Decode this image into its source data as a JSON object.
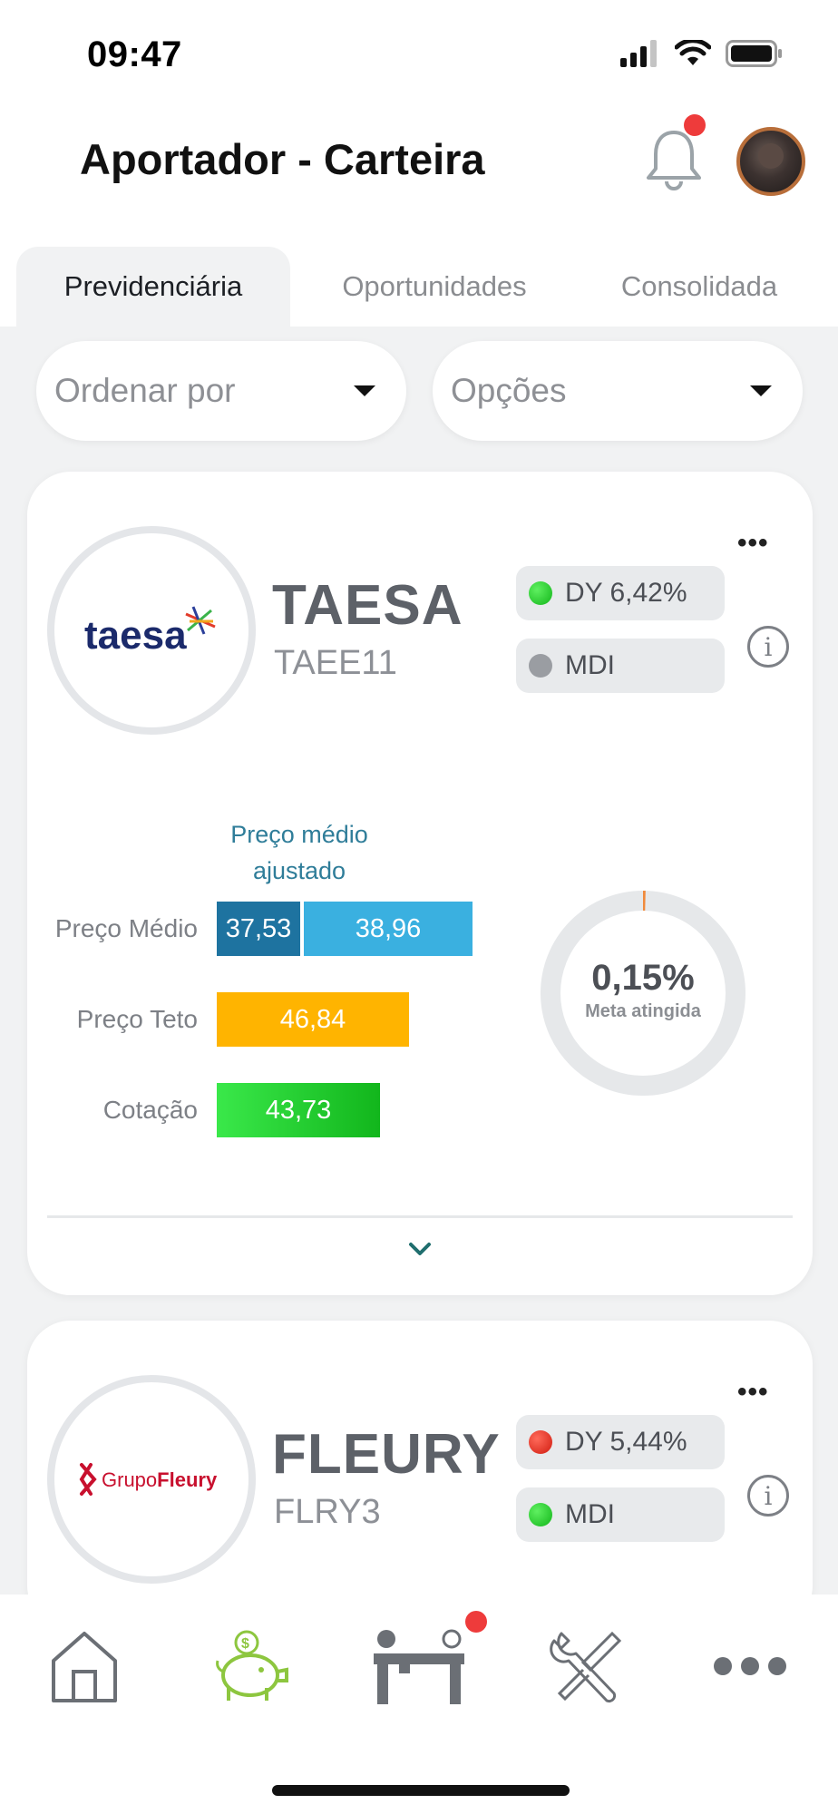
{
  "status_bar": {
    "time": "09:47"
  },
  "header": {
    "title": "Aportador - Carteira"
  },
  "tabs": [
    {
      "label": "Previdenciária",
      "active": true
    },
    {
      "label": "Oportunidades",
      "active": false
    },
    {
      "label": "Consolidada",
      "active": false
    }
  ],
  "filters": {
    "sort_label": "Ordenar por",
    "options_label": "Opções"
  },
  "cards": [
    {
      "company": "TAESA",
      "ticker": "TAEE11",
      "logo_text": "taesa",
      "dy_label": "DY 6,42%",
      "dy_status": "green",
      "mdi_label": "MDI",
      "mdi_status": "gray",
      "adjusted_label": "Preço médio ajustado",
      "rows": {
        "preco_medio_label": "Preço Médio",
        "preco_medio_value": "37,53",
        "preco_medio_ajustado_value": "38,96",
        "preco_teto_label": "Preço Teto",
        "preco_teto_value": "46,84",
        "cotacao_label": "Cotação",
        "cotacao_value": "43,73"
      },
      "goal_value": "0,15%",
      "goal_fraction": 0.0015,
      "goal_label": "Meta atingida"
    },
    {
      "company": "FLEURY",
      "ticker": "FLRY3",
      "logo_text_prefix": "Grupo",
      "logo_text_brand": "Fleury",
      "dy_label": "DY 5,44%",
      "dy_status": "red",
      "mdi_label": "MDI",
      "mdi_status": "green"
    }
  ],
  "colors": {
    "accent_blue": "#2f7d99",
    "preco_medio": "#1e73a0",
    "preco_ajustado": "#3ab0e0",
    "preco_teto": "#ffb400",
    "cotacao": "#12b61c",
    "notification": "#ee3b3b",
    "nav_active": "#8dc63f"
  },
  "bottom_nav": [
    {
      "icon": "home-icon"
    },
    {
      "icon": "piggy-bank-icon",
      "active": true
    },
    {
      "icon": "desk-icon",
      "has_notification": true
    },
    {
      "icon": "tools-icon"
    },
    {
      "icon": "more-icon"
    }
  ]
}
